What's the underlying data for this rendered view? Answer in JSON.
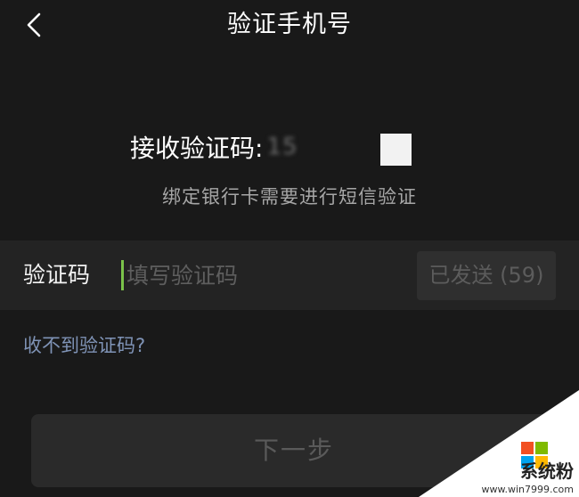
{
  "header": {
    "title": "验证手机号",
    "back_icon": "chevron-left-icon"
  },
  "receive": {
    "label": "接收验证码:",
    "phone_masked": "15"
  },
  "hint": "绑定银行卡需要进行短信验证",
  "code_row": {
    "label": "验证码",
    "input_value": "",
    "input_placeholder": "填写验证码",
    "resend_label": "已发送 (59)"
  },
  "no_code_link": "收不到验证码?",
  "next_button": "下一步",
  "watermark": {
    "text": "系统粉",
    "url": "www.win7999.com"
  },
  "colors": {
    "background": "#191919",
    "row_background": "#232323",
    "caret": "#7bc34a",
    "link": "#7f93b6",
    "disabled_text": "#5a5a5a"
  }
}
